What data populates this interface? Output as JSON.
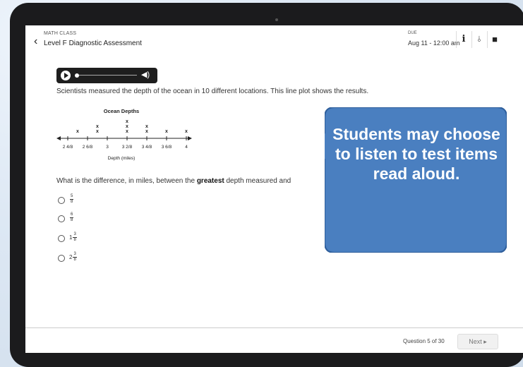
{
  "header": {
    "course": "MATH CLASS",
    "title": "Level F Diagnostic Assessment",
    "due_label": "DUE",
    "due_date": "Aug 11 - 12:00 am",
    "icons": [
      "info-icon",
      "paperclip-icon",
      "comment-icon"
    ]
  },
  "audio": {
    "icons": [
      "play-icon",
      "volume-icon"
    ]
  },
  "prompt": "Scientists measured the depth of the ocean in 10 different locations. This line plot shows the results.",
  "chart_data": {
    "type": "line plot",
    "title": "Ocean Depths",
    "xlabel": "Depth (miles)",
    "ticks": [
      "2 4/8",
      "2 6/8",
      "3",
      "3 2/8",
      "3 4/8",
      "3 6/8",
      "4"
    ],
    "x_values": [
      2.625,
      2.875,
      3.25,
      3.5,
      3.75,
      4.0
    ],
    "counts": [
      1,
      2,
      3,
      2,
      1,
      1
    ],
    "marker": "x"
  },
  "question": {
    "before": "What is the difference, in miles, between the ",
    "bold": "greatest",
    "after": " depth measured and"
  },
  "choices": [
    {
      "whole": "",
      "num": "5",
      "den": "8"
    },
    {
      "whole": "",
      "num": "6",
      "den": "8"
    },
    {
      "whole": "1",
      "num": "3",
      "den": "8"
    },
    {
      "whole": "2",
      "num": "3",
      "den": "8"
    }
  ],
  "footer": {
    "question_count": "Question 5 of 30",
    "next_label": "Next"
  },
  "callout": {
    "text": "Students may choose to listen to test items read aloud.",
    "color": "#4a7fc0"
  }
}
